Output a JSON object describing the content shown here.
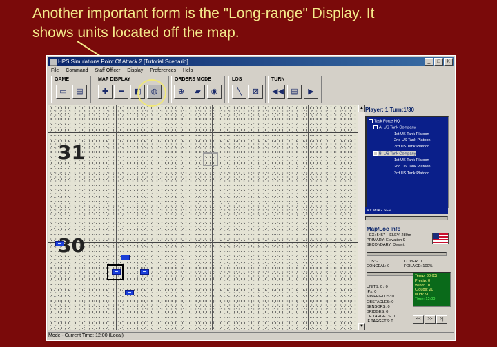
{
  "caption": {
    "line1": "Another important form is the \"Long-range\" Display.  It",
    "line2": "shows units located off the map."
  },
  "window": {
    "title": "HPS Simulations Point Of Attack 2 [Tutorial Scenario]",
    "controls": {
      "minimize": "_",
      "maximize": "□",
      "close": "X"
    }
  },
  "menu": [
    "File",
    "Command",
    "Staff Officer",
    "Display",
    "Preferences",
    "Help"
  ],
  "toolbar": {
    "groups": {
      "game": "GAME",
      "map_display": "MAP DISPLAY",
      "orders_mode": "ORDERS MODE",
      "los": "LOS",
      "turn": "TURN"
    }
  },
  "map": {
    "row_labels": {
      "top": "31",
      "bottom": "30"
    }
  },
  "panel": {
    "player_turn": "Player: 1   Turn:1/30",
    "tree": [
      "Task Force HQ",
      "A: US Tank Company",
      "1st US Tank Platoon",
      "2nd US Tank Platoon",
      "3rd US Tank Platoon",
      "B: US Tank Company",
      "1st US Tank Platoon",
      "2nd US Tank Platoon",
      "3rd US Tank Platoon"
    ],
    "selected_unit": "4 x M1A2 SEP",
    "info_title": "Map/Loc Info",
    "hex": "HEX: 5457",
    "elev": "ELEV: 280m",
    "primary": "PRIMARY: Elevation 9",
    "secondary": "SECONDARY: Desert",
    "los": "LOS: -",
    "cover": "COVER: 0",
    "conceal": "CONCEAL: 0",
    "foilage": "FOILAGE: 100%",
    "units_list": [
      "UNITS: 0 / 0",
      "IPs: 0",
      "MINEFIELDS: 0",
      "OBSTACLES: 0",
      "SENSORS: 0",
      "BRIDGES: 0",
      "DF TARGETS: 0",
      "IF TARGETS: 0"
    ],
    "weather": [
      "Temp: 30 (C)",
      "Precip: 0",
      "Wind: 10",
      "Clouds: 20",
      "Illum: 90"
    ],
    "weather_time": "Time: 12:00",
    "nav": [
      "<<",
      ">>",
      ">|"
    ]
  },
  "statusbar": "Mode:- Current Time: 12:00 (Local)",
  "colors": {
    "background": "#7a0a0a",
    "caption": "#f4e98a",
    "tree_bg": "#0a1f8a",
    "weather_bg": "#0a6a1a",
    "unit": "#1a3ed8"
  }
}
